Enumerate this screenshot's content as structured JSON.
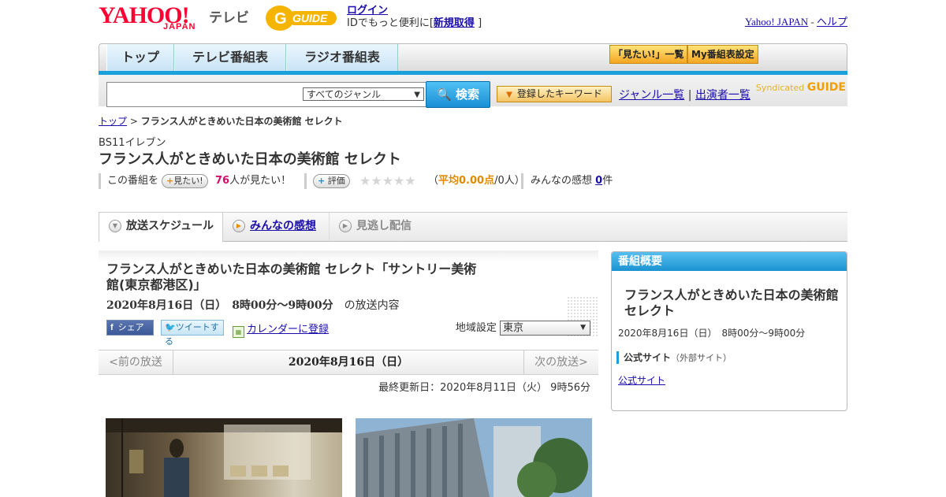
{
  "header": {
    "yahoo_logo": "YAHOO!",
    "japan_logo": "JAPAN",
    "tv_label": "テレビ",
    "gguide_logo": "GUIDE",
    "login": "ログイン",
    "login_sub_prefix": "IDでもっと便利に[",
    "register": "新規取得",
    "login_sub_suffix": "]",
    "yahoo_japan_link": "Yahoo! JAPAN",
    "separator": "-",
    "help_link": "ヘルプ"
  },
  "nav": {
    "tabs": [
      "トップ",
      "テレビ番組表",
      "ラジオ番組表"
    ],
    "want_list": "「見たい!」一覧",
    "my_schedule": "My番組表設定"
  },
  "search": {
    "genre_selected": "すべてのジャンル",
    "search_button": "検索",
    "keyword_button": "登録したキーワード",
    "genre_list_link": "ジャンル一覧",
    "link_sep": "|",
    "cast_list_link": "出演者一覧",
    "syndicated": "Syndicated",
    "syndicated_logo": "GUIDE"
  },
  "breadcrumb": {
    "top": "トップ",
    "sep": ">",
    "current": "フランス人がときめいた日本の美術館 セレクト"
  },
  "program": {
    "channel": "BS11イレブン",
    "title": "フランス人がときめいた日本の美術館 セレクト",
    "stats": {
      "this_program": "この番組を",
      "want_button": "見たい!",
      "want_count": "76",
      "want_suffix": "人が見たい！",
      "rate_button": "評価",
      "stars": "★★★★★",
      "avg_open": "（",
      "avg_label": "平均0.00点",
      "avg_people": "/0人）",
      "impressions_label": "みんなの感想",
      "impressions_count": "0",
      "impressions_suffix": "件"
    }
  },
  "tabs": {
    "schedule": "放送スケジュール",
    "impressions": "みんなの感想",
    "missed": "見逃し配信"
  },
  "episode": {
    "title": "フランス人がときめいた日本の美術館 セレクト「サントリー美術館(東京都港区)」",
    "datetime": "2020年8月16日（日）　8時00分～9時00分",
    "datetime_suffix": "の放送内容",
    "share": "シェア",
    "tweet": "ツイートする",
    "calendar": "カレンダーに登録",
    "region_label": "地域設定",
    "region_value": "東京",
    "prev": "<前の放送",
    "current_date": "2020年8月16日（日）",
    "next": "次の放送>",
    "updated": "最終更新日：2020年8月11日（火） 9時56分"
  },
  "sidebar": {
    "head": "番組概要",
    "title": "フランス人がときめいた日本の美術館 セレクト",
    "datetime": "2020年8月16日（日）　8時00分～9時00分",
    "official_head": "公式サイト",
    "official_sub": "（外部サイト）",
    "official_link": "公式サイト"
  },
  "colors": {
    "accent_blue": "#1aa1dc",
    "yahoo_red": "#ff0033",
    "orange": "#f4a621",
    "pink": "#d40d6d"
  }
}
